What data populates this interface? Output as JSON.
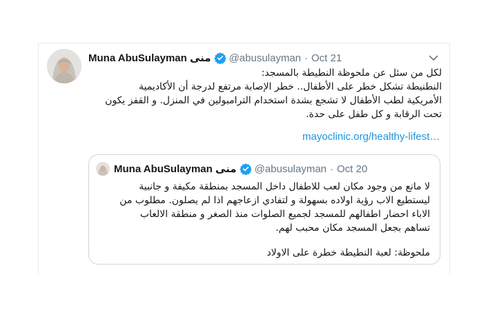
{
  "tweet": {
    "author_name": "Muna AbuSulayman منى",
    "handle": "@abusulayman",
    "separator": "·",
    "date": "Oct 21",
    "text_lines": [
      "لكل من سئل عن ملحوظة النطيطة بالمسجد:",
      "النطنيطة تشكل خطر على الأطفال..  خطر الإصابة مرتفع لدرجة أن الأكاديمية",
      "الأمريكية لطب الأطفال لا تشجع بشدة استخدام الترامبولين في المنزل. و القفز يكون",
      "تحت الرقابة و كل طفل على حدة."
    ],
    "link_text": "mayoclinic.org/healthy-lifest…",
    "icons": {
      "verified": "verified-badge-icon",
      "caret": "chevron-down-icon"
    },
    "colors": {
      "verified": "#1da1f2",
      "link": "#1b95e0",
      "muted": "#657786"
    }
  },
  "quoted_tweet": {
    "author_name": "Muna AbuSulayman منى",
    "handle": "@abusulayman",
    "separator": "·",
    "date": "Oct 20",
    "text_lines": [
      "لا مانع من وجود مكان لعب للاطفال داخل المسجد بمنطقة مكيفة و جانبية",
      "ليستطيع الاب رؤية اولاده بسهولة و لتفادي ازعاجهم اذا لم يصلون. مطلوب من",
      "الاباء احضار اطفالهم للمسجد لجميع الصلوات منذ الصغر و منطقة الالعاب",
      "تساهم بجعل المسجد مكان محبب لهم."
    ],
    "note_line": "ملحوظة: لعبة النطيطة خطرة على الاولاد"
  }
}
